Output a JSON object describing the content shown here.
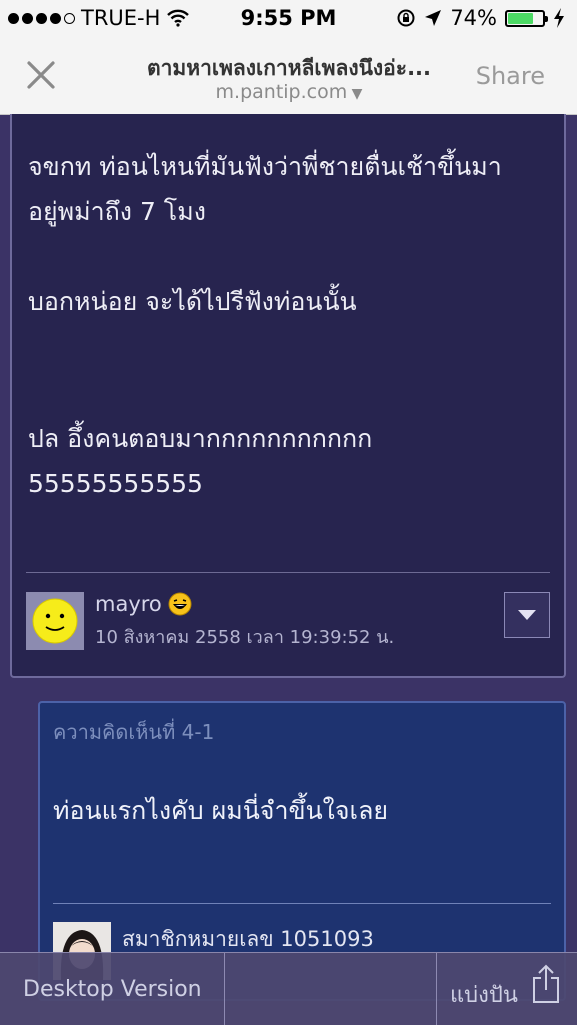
{
  "status_bar": {
    "carrier": "TRUE-H",
    "time": "9:55 PM",
    "battery_percent": "74%",
    "signal_bars_filled": 4,
    "signal_bars_total": 5,
    "battery_level": 0.74,
    "icons": [
      "wifi-icon",
      "rotation-lock-icon",
      "location-arrow-icon",
      "battery-icon",
      "charging-bolt-icon"
    ]
  },
  "nav": {
    "title": "ตามหาเพลงเกาหลีเพลงนึงอ่ะ...",
    "domain": "m.pantip.com",
    "share_label": "Share",
    "close_icon": "close-icon"
  },
  "comment": {
    "lines_1": [
      "จขกท ท่อนไหนที่มันฟังว่าพี่ชายตื่นเช้าขึ้นมา",
      "อยู่พม่าถึง 7 โมง"
    ],
    "line_2": "บอกหน่อย จะได้ไปรีฟังท่อนนั้น",
    "lines_3": [
      "ปล อึ้งคนตอบมากกกกกกกกกกก",
      "55555555555"
    ],
    "author": "mayro",
    "date": "10 สิงหาคม 2558 เวลา 19:39:52 น.",
    "emoji_icon": "laughing-emoji-icon",
    "avatar_icon": "smiley-avatar"
  },
  "reply": {
    "label": "ความคิดเห็นที่ 4-1",
    "body": "ท่อนแรกไงคับ ผมนี่จำขึ้นใจเลย",
    "author": "สมาชิกหมายเลข 1051093"
  },
  "bottom_bar": {
    "desktop_label": "Desktop Version",
    "share_label": "แบ่งปัน",
    "share_icon": "share-icon"
  },
  "colors": {
    "background": "#3b3366",
    "comment_bg": "#27244f",
    "reply_bg": "#1e3370",
    "battery_fill": "#4cd964"
  }
}
